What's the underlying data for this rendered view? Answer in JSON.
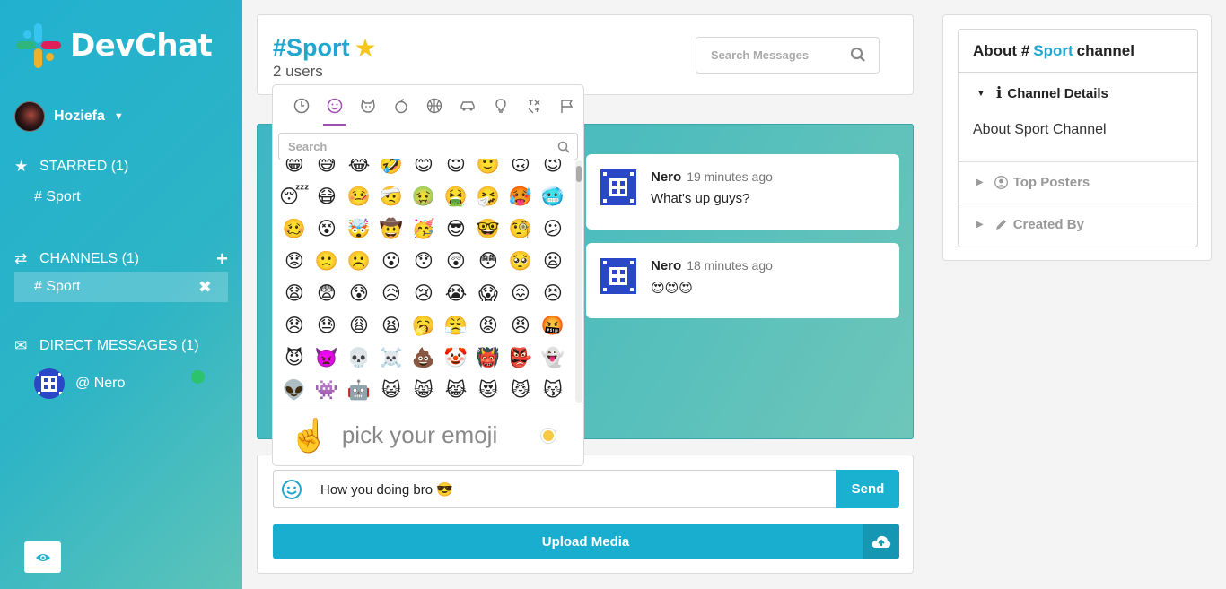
{
  "sidebar": {
    "brand": "DevChat",
    "user_name": "Hoziefa",
    "starred_label": "STARRED (1)",
    "starred_items": [
      "# Sport"
    ],
    "channels_label": "CHANNELS (1)",
    "channel_items": [
      "# Sport"
    ],
    "dm_label": "DIRECT MESSAGES (1)",
    "dm_items": [
      "@ Nero"
    ],
    "colors": {
      "accent": "#21b1cf",
      "online": "#2bc36b"
    }
  },
  "header": {
    "channel_title": "#Sport",
    "users_count": "2 users",
    "search_placeholder": "Search Messages"
  },
  "messages": [
    {
      "author": "Nero",
      "time": "19 minutes ago",
      "text": "What's up guys?"
    },
    {
      "author": "Nero",
      "time": "18 minutes ago",
      "text": "😍😍😍"
    }
  ],
  "compose": {
    "input_value": "How you doing bro 😎",
    "send_label": "Send",
    "upload_label": "Upload Media"
  },
  "emoji_picker": {
    "categories": [
      "clock-icon",
      "smiley-icon",
      "animal-icon",
      "food-icon",
      "ball-icon",
      "car-icon",
      "bulb-icon",
      "symbols-icon",
      "flag-icon"
    ],
    "search_placeholder": "Search",
    "rows": [
      [
        "😁",
        "😅",
        "😂",
        "🤣",
        "😊",
        "😇",
        "🙂",
        "🙃",
        "😉"
      ],
      [
        "😴",
        "😷",
        "🤒",
        "🤕",
        "🤢",
        "🤮",
        "🤧",
        "🥵",
        "🥶"
      ],
      [
        "🥴",
        "😵",
        "🤯",
        "🤠",
        "🥳",
        "😎",
        "🤓",
        "🧐",
        "😕"
      ],
      [
        "😟",
        "🙁",
        "☹️",
        "😮",
        "😯",
        "😲",
        "😳",
        "🥺",
        "😦"
      ],
      [
        "😧",
        "😨",
        "😰",
        "😥",
        "😢",
        "😭",
        "😱",
        "😖",
        "😣"
      ],
      [
        "😞",
        "😓",
        "😩",
        "😫",
        "🥱",
        "😤",
        "😡",
        "😠",
        "🤬"
      ],
      [
        "😈",
        "👿",
        "💀",
        "☠️",
        "💩",
        "🤡",
        "👹",
        "👺",
        "👻"
      ],
      [
        "👽",
        "👾",
        "🤖",
        "😺",
        "😸",
        "😹",
        "😻",
        "😼",
        "😽"
      ]
    ],
    "preview_emoji": "☝️",
    "preview_text": "pick your emoji"
  },
  "about": {
    "title_prefix": "About #",
    "title_channel": "Sport",
    "title_suffix": "channel",
    "details_label": "Channel Details",
    "details_text": "About Sport Channel",
    "top_posters_label": "Top Posters",
    "created_by_label": "Created By"
  }
}
